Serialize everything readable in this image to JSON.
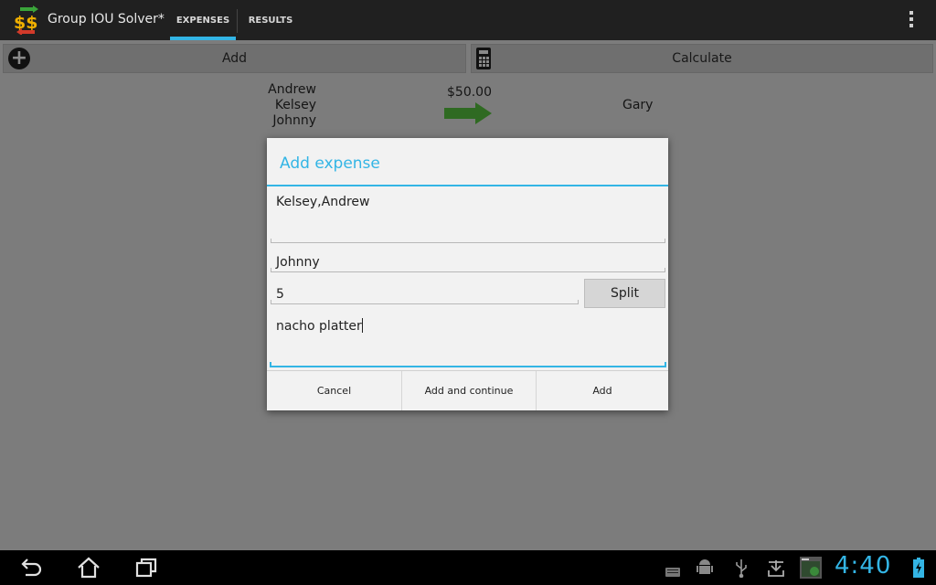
{
  "app": {
    "title": "Group IOU Solver*"
  },
  "tabs": [
    {
      "label": "EXPENSES",
      "selected": true
    },
    {
      "label": "RESULTS",
      "selected": false
    }
  ],
  "toolbar": {
    "add_label": "Add",
    "calculate_label": "Calculate"
  },
  "expense": {
    "payers": [
      "Andrew",
      "Kelsey",
      "Johnny"
    ],
    "amount": "$50.00",
    "payee": "Gary"
  },
  "dialog": {
    "title": "Add expense",
    "payers_value": "Kelsey,Andrew",
    "payee_value": "Johnny",
    "amount_value": "5",
    "split_label": "Split",
    "description_value": "nacho platter",
    "cancel_label": "Cancel",
    "add_continue_label": "Add and continue",
    "add_label": "Add"
  },
  "status": {
    "time": "4:40"
  },
  "colors": {
    "accent": "#33b5e5",
    "arrow": "#3a9a2a"
  }
}
